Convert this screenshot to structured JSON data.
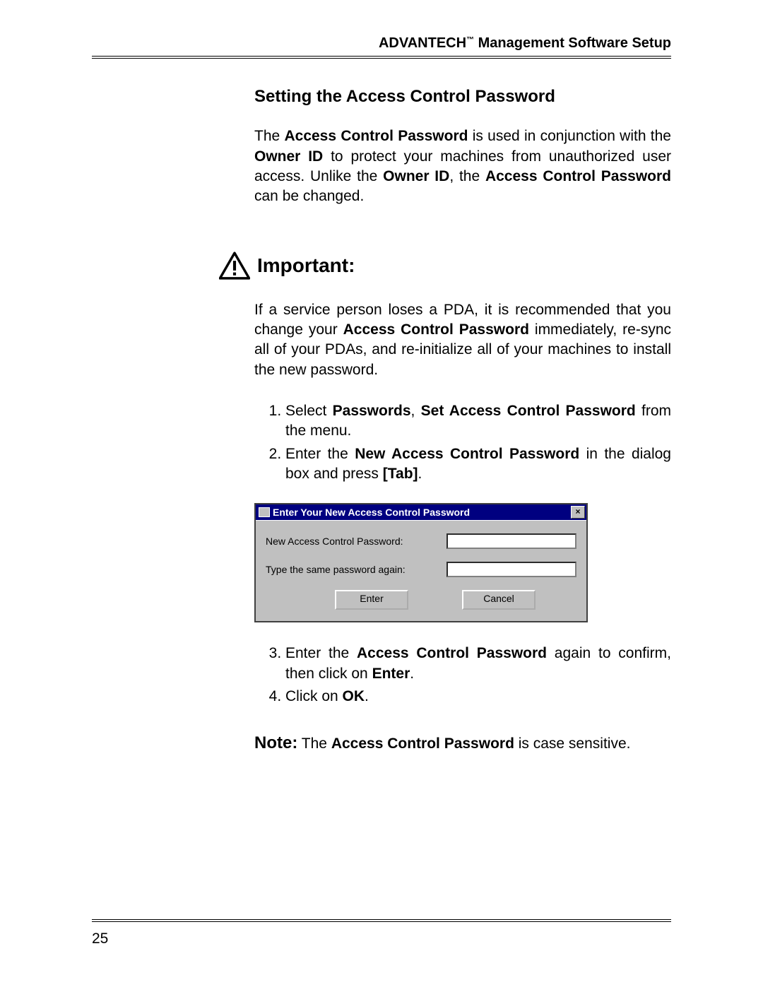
{
  "header": {
    "brand": "ADVANTECH",
    "tm": "™",
    "subtitle": " Management Software Setup"
  },
  "section": {
    "title": "Setting the Access Control Password"
  },
  "intro": {
    "t1": "The ",
    "t2": "Access Control Password",
    "t3": " is used in conjunction with the ",
    "t4": "Owner ID",
    "t5": " to protect your machines from unauthorized user access. Unlike the ",
    "t6": "Owner ID",
    "t7": ", the ",
    "t8": "Access Control Password",
    "t9": " can be changed."
  },
  "important": {
    "label": "Important:",
    "t1": "If a service person loses a PDA, it is recommended that you change your ",
    "t2": "Access Control Password",
    "t3": " immediately, re-sync all of your PDAs, and re-initialize all of your machines to install the new password."
  },
  "steps12": {
    "s1a": "Select ",
    "s1b": "Passwords",
    "s1c": ", ",
    "s1d": "Set Access Control Password",
    "s1e": " from the menu.",
    "s2a": "Enter the ",
    "s2b": "New Access Control Password",
    "s2c": " in the dialog box and press ",
    "s2d": "[Tab]",
    "s2e": "."
  },
  "dialog": {
    "title": "Enter Your New Access Control Password",
    "field1": "New Access Control Password:",
    "field2": "Type the same password again:",
    "enter": "Enter",
    "cancel": "Cancel",
    "close": "×"
  },
  "steps34": {
    "s3a": "Enter the ",
    "s3b": "Access Control Password",
    "s3c": " again to confirm, then click on ",
    "s3d": "Enter",
    "s3e": ".",
    "s4a": "Click on ",
    "s4b": "OK",
    "s4c": "."
  },
  "note": {
    "label": "Note:",
    "t1": " The ",
    "t2": "Access Control Password",
    "t3": " is case sensitive."
  },
  "pageNumber": "25"
}
